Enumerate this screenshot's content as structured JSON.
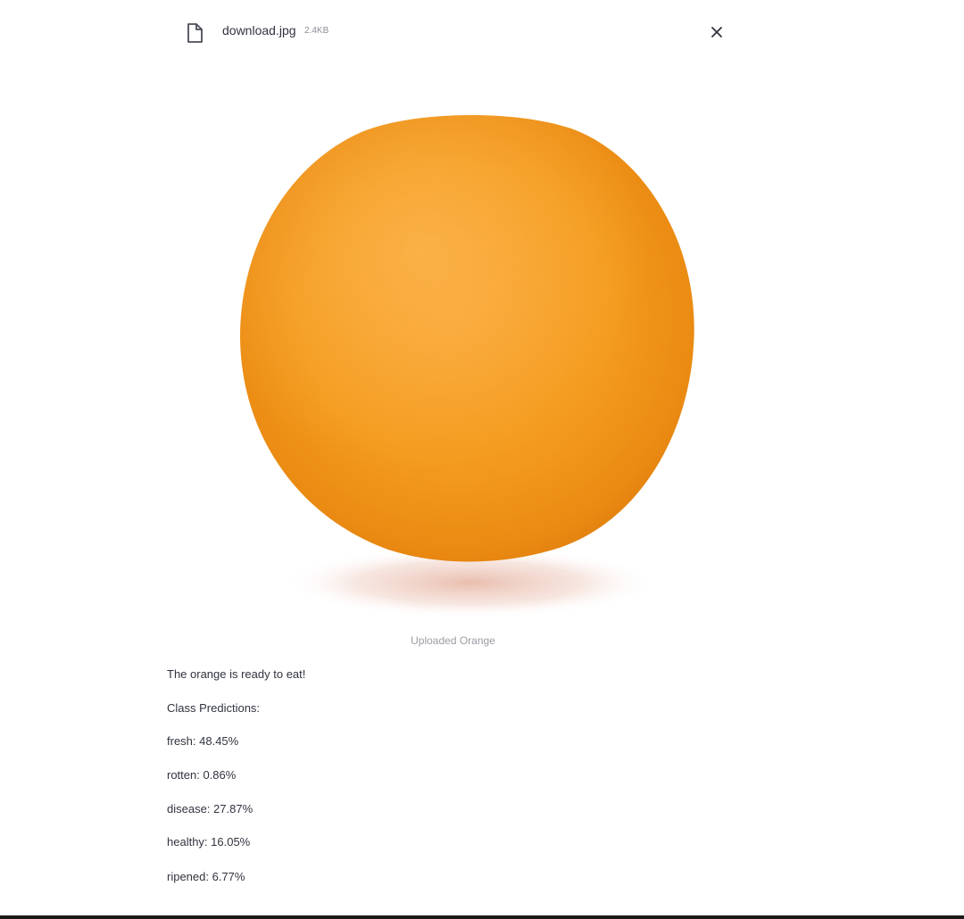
{
  "uploaded_file": {
    "name": "download.jpg",
    "size": "2.4KB",
    "file_icon": "file-icon",
    "remove_icon": "close-icon"
  },
  "image": {
    "subject": "orange",
    "caption": "Uploaded Orange"
  },
  "result": {
    "verdict": "The orange is ready to eat!",
    "predictions_header": "Class Predictions:",
    "predictions": [
      {
        "text": "fresh: 48.45%"
      },
      {
        "text": "rotten: 0.86%"
      },
      {
        "text": "disease: 27.87%"
      },
      {
        "text": "healthy: 16.05%"
      },
      {
        "text": "ripened: 6.77%"
      }
    ]
  },
  "colors": {
    "text": "#31333f",
    "muted": "#8a8d96",
    "orange": "#f59a1a"
  }
}
